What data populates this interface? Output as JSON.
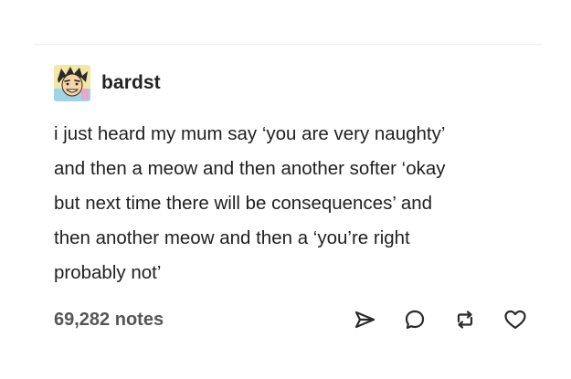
{
  "post": {
    "author": {
      "username": "bardst",
      "avatar_icon": "cartoon-face-avatar"
    },
    "body_lines": [
      "i just heard my mum say ‘you are very naughty’",
      "and then a meow and then another softer ‘okay",
      "but next time there will be consequences’ and",
      "then another meow and then a ‘you’re right",
      "probably not’"
    ],
    "notes": "69,282 notes",
    "actions": [
      {
        "name": "share",
        "icon": "paper-plane-icon"
      },
      {
        "name": "reply",
        "icon": "speech-bubble-icon"
      },
      {
        "name": "reblog",
        "icon": "reblog-icon"
      },
      {
        "name": "like",
        "icon": "heart-icon"
      }
    ]
  },
  "colors": {
    "text": "#1f1f1f",
    "muted": "#555555",
    "divider": "#eeeeee",
    "icon": "#2b2b2b"
  }
}
